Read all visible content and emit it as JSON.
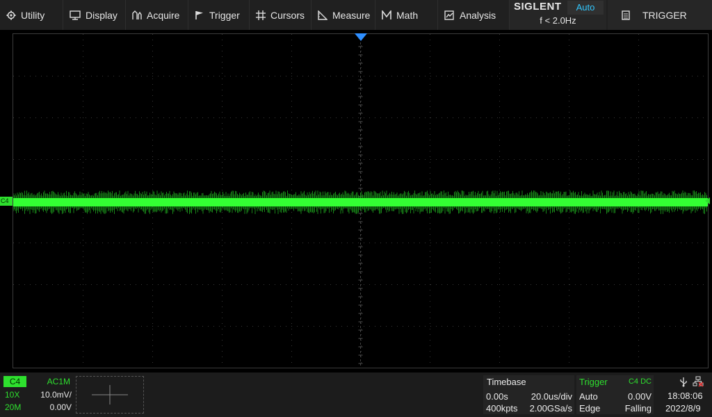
{
  "menu": [
    {
      "label": "Utility",
      "icon": "gear-icon"
    },
    {
      "label": "Display",
      "icon": "monitor-icon"
    },
    {
      "label": "Acquire",
      "icon": "acquire-icon"
    },
    {
      "label": "Trigger",
      "icon": "flag-icon"
    },
    {
      "label": "Cursors",
      "icon": "crosshair-icon"
    },
    {
      "label": "Measure",
      "icon": "ruler-icon"
    },
    {
      "label": "Math",
      "icon": "math-icon"
    },
    {
      "label": "Analysis",
      "icon": "analysis-icon"
    }
  ],
  "brand": {
    "name": "SIGLENT",
    "mode": "Auto",
    "freq": "f < 2.0Hz"
  },
  "trigger_menu": {
    "label": "TRIGGER",
    "icon": "clipboard-icon"
  },
  "screen": {
    "channel_marker": "C4",
    "trace_color": "#2ee02e",
    "trigger_marker_color": "#2f8fff"
  },
  "channel": {
    "name": "C4",
    "coupling": "AC1M",
    "probe": "10X",
    "scale": "10.0mV/",
    "bandwidth": "20M",
    "offset": "0.00V",
    "color": "#2ee02e"
  },
  "timebase": {
    "title": "Timebase",
    "delay": "0.00s",
    "scale": "20.0us/div",
    "memory": "400kpts",
    "sample_rate": "2.00GSa/s"
  },
  "trigger": {
    "title": "Trigger",
    "source": "C4 DC",
    "mode": "Auto",
    "level": "0.00V",
    "type": "Edge",
    "slope": "Falling"
  },
  "system": {
    "time": "18:08:06",
    "date": "2022/8/9",
    "usb_icon": "usb-icon",
    "network_icon": "network-icon"
  }
}
